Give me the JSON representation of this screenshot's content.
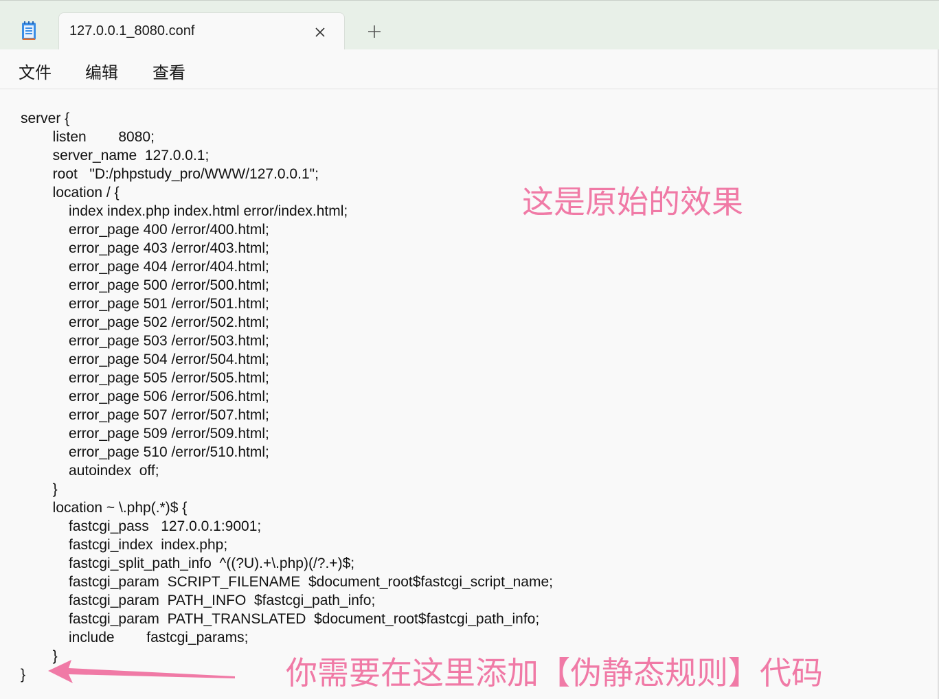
{
  "tab": {
    "title": "127.0.0.1_8080.conf"
  },
  "icons": {
    "app": "notepad-icon",
    "close": "close-icon",
    "add": "plus-icon"
  },
  "menu": {
    "items": [
      "文件",
      "编辑",
      "查看"
    ]
  },
  "editor": {
    "lines": [
      "server {",
      "        listen        8080;",
      "        server_name  127.0.0.1;",
      "        root   \"D:/phpstudy_pro/WWW/127.0.0.1\";",
      "        location / {",
      "            index index.php index.html error/index.html;",
      "            error_page 400 /error/400.html;",
      "            error_page 403 /error/403.html;",
      "            error_page 404 /error/404.html;",
      "            error_page 500 /error/500.html;",
      "            error_page 501 /error/501.html;",
      "            error_page 502 /error/502.html;",
      "            error_page 503 /error/503.html;",
      "            error_page 504 /error/504.html;",
      "            error_page 505 /error/505.html;",
      "            error_page 506 /error/506.html;",
      "            error_page 507 /error/507.html;",
      "            error_page 509 /error/509.html;",
      "            error_page 510 /error/510.html;",
      "            autoindex  off;",
      "        }",
      "        location ~ \\.php(.*)$ {",
      "            fastcgi_pass   127.0.0.1:9001;",
      "            fastcgi_index  index.php;",
      "            fastcgi_split_path_info  ^((?U).+\\.php)(/?.+)$;",
      "            fastcgi_param  SCRIPT_FILENAME  $document_root$fastcgi_script_name;",
      "            fastcgi_param  PATH_INFO  $fastcgi_path_info;",
      "            fastcgi_param  PATH_TRANSLATED  $document_root$fastcgi_path_info;",
      "            include        fastcgi_params;",
      "        }",
      "}"
    ]
  },
  "annotations": {
    "original_effect": "这是原始的效果",
    "add_here": "你需要在这里添加【伪静态规则】代码",
    "color": "#f07aa6"
  }
}
